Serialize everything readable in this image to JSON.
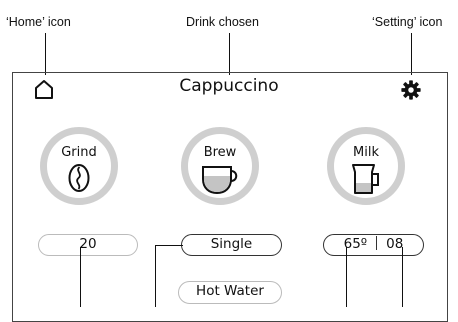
{
  "annotations": {
    "home_icon": "‘Home’ icon",
    "drink_chosen": "Drink chosen",
    "setting_icon": "‘Setting’ icon"
  },
  "header": {
    "title": "Cappuccino"
  },
  "controls": {
    "grind": {
      "label": "Grind",
      "value": "20"
    },
    "brew": {
      "label": "Brew",
      "value": "Single"
    },
    "milk": {
      "label": "Milk",
      "temperature": "65º",
      "amount": "08"
    }
  },
  "hot_water": {
    "label": "Hot Water"
  },
  "colors": {
    "ring": "#cfcfcf",
    "liquid": "#c4c4c4",
    "line": "#111111"
  }
}
